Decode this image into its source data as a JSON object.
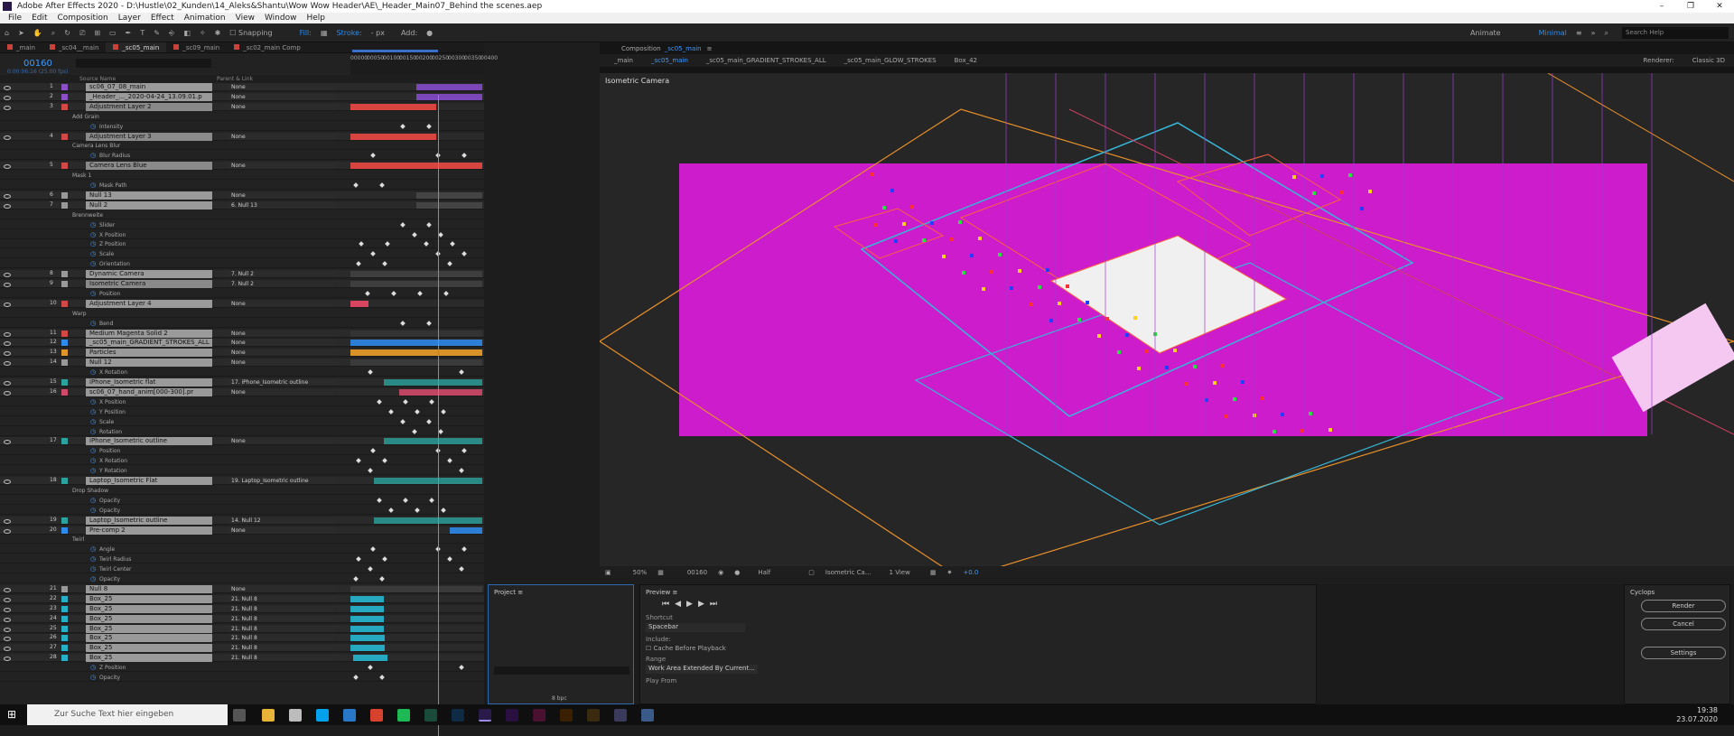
{
  "window": {
    "title": "Adobe After Effects 2020 - D:\\Hustle\\02_Kunden\\14_Aleks&Shantu\\Wow Wow Header\\AE\\_Header_Main07_Behind the scenes.aep"
  },
  "menu": [
    "File",
    "Edit",
    "Composition",
    "Layer",
    "Effect",
    "Animation",
    "View",
    "Window",
    "Help"
  ],
  "toolbar": {
    "snapping": "Snapping",
    "fill": "Fill:",
    "stroke": "Stroke:",
    "px": "- px",
    "add": "Add:",
    "workspace_animate": "Animate",
    "workspace_minimal": "Minimal",
    "search_placeholder": "Search Help"
  },
  "timeline": {
    "tabs": [
      {
        "label": "_main",
        "color": "#c8433a"
      },
      {
        "label": "_sc04__main",
        "color": "#c8433a"
      },
      {
        "label": "_sc05_main",
        "color": "#c8433a"
      },
      {
        "label": "_sc09_main",
        "color": "#c8433a"
      },
      {
        "label": "_sc02_main Comp",
        "color": "#c8433a"
      }
    ],
    "timecode": "00160",
    "timecode_sub": "0:00:06:16 (25.00 fps)",
    "ruler": [
      "00000",
      "00050",
      "00100",
      "00150",
      "00200",
      "00250",
      "00300",
      "00350",
      "00400"
    ],
    "header": {
      "source": "Source Name",
      "parent": "Parent & Link"
    },
    "rows": [
      {
        "n": "1",
        "name": "sc06_07_08_main",
        "parent": "None",
        "color": "#8b4fc7",
        "bar": [
          50,
          100
        ],
        "barcolor": "#7a46b8",
        "kind": "layer"
      },
      {
        "n": "2",
        "name": "_Header_..._2020-04-24_13.09.01.p",
        "parent": "None",
        "color": "#8b4fc7",
        "bar": [
          50,
          100
        ],
        "barcolor": "#7a46b8",
        "kind": "layer"
      },
      {
        "n": "3",
        "name": "Adjustment Layer 2",
        "parent": "None",
        "color": "#d24845",
        "bar": [
          0,
          65
        ],
        "barcolor": "#d84540",
        "kind": "sel"
      },
      {
        "n": "",
        "name": "Add Grain",
        "kind": "group"
      },
      {
        "n": "",
        "name": "Intensity",
        "kind": "prop"
      },
      {
        "n": "4",
        "name": "Adjustment Layer 3",
        "parent": "None",
        "color": "#d24845",
        "bar": [
          0,
          65
        ],
        "barcolor": "#d84540",
        "kind": "sel"
      },
      {
        "n": "",
        "name": "Camera Lens Blur",
        "kind": "group"
      },
      {
        "n": "",
        "name": "Blur Radius",
        "kind": "prop"
      },
      {
        "n": "5",
        "name": "Camera Lens Blue",
        "parent": "None",
        "color": "#d24845",
        "bar": [
          0,
          100
        ],
        "barcolor": "#d84540",
        "kind": "sel"
      },
      {
        "n": "",
        "name": "Mask 1",
        "kind": "group"
      },
      {
        "n": "",
        "name": "Mask Path",
        "kind": "prop"
      },
      {
        "n": "6",
        "name": "Null 13",
        "parent": "None",
        "color": "#999999",
        "bar": [
          50,
          100
        ],
        "barcolor": "#444444",
        "kind": "layer"
      },
      {
        "n": "7",
        "name": "Null 2",
        "parent": "6. Null 13",
        "color": "#999999",
        "bar": [
          50,
          100
        ],
        "barcolor": "#444444",
        "kind": "layer"
      },
      {
        "n": "",
        "name": "Brennweite",
        "kind": "group"
      },
      {
        "n": "",
        "name": "Slider",
        "kind": "prop"
      },
      {
        "n": "",
        "name": "X Position",
        "kind": "prop"
      },
      {
        "n": "",
        "name": "Z Position",
        "kind": "prop"
      },
      {
        "n": "",
        "name": "Scale",
        "kind": "prop"
      },
      {
        "n": "",
        "name": "Orientation",
        "kind": "prop"
      },
      {
        "n": "8",
        "name": "Dynamic Camera",
        "parent": "7. Null 2",
        "color": "#999999",
        "bar": [
          0,
          100
        ],
        "barcolor": "#3e3e3e",
        "kind": "layer"
      },
      {
        "n": "9",
        "name": "Isometric Camera",
        "parent": "7. Null 2",
        "color": "#999999",
        "bar": [
          0,
          100
        ],
        "barcolor": "#3e3e3e",
        "kind": "sel"
      },
      {
        "n": "",
        "name": "Position",
        "kind": "prop"
      },
      {
        "n": "10",
        "name": "Adjustment Layer 4",
        "parent": "None",
        "color": "#d24845",
        "bar": [
          0,
          14
        ],
        "barcolor": "#d84560",
        "kind": "layer"
      },
      {
        "n": "",
        "name": "Warp",
        "kind": "group"
      },
      {
        "n": "",
        "name": "Bend",
        "kind": "prop"
      },
      {
        "n": "11",
        "name": "Medium Magenta Solid 2",
        "parent": "None",
        "color": "#d24845",
        "bar": [
          0,
          100
        ],
        "barcolor": "#333333",
        "kind": "layer"
      },
      {
        "n": "12",
        "name": "_sc05_main_GRADIENT_STROKES_ALL",
        "parent": "None",
        "color": "#2d8ceb",
        "bar": [
          0,
          100
        ],
        "barcolor": "#2d7fd6",
        "kind": "layer"
      },
      {
        "n": "13",
        "name": "Particles",
        "parent": "None",
        "color": "#e0952a",
        "bar": [
          0,
          100
        ],
        "barcolor": "#d89228",
        "kind": "layer"
      },
      {
        "n": "14",
        "name": "Null 12",
        "parent": "None",
        "color": "#999999",
        "bar": [
          0,
          100
        ],
        "barcolor": "#3a3a3a",
        "kind": "layer"
      },
      {
        "n": "",
        "name": "X Rotation",
        "kind": "prop"
      },
      {
        "n": "15",
        "name": "iPhone_Isometric flat",
        "parent": "17. iPhone_Isometric outline",
        "color": "#2aa39e",
        "bar": [
          25,
          100
        ],
        "barcolor": "#2a8b86",
        "kind": "layer"
      },
      {
        "n": "16",
        "name": "sc06_07_hand_anim[000-300].pr",
        "parent": "None",
        "color": "#d24868",
        "bar": [
          37,
          100
        ],
        "barcolor": "#c04562",
        "kind": "layer"
      },
      {
        "n": "",
        "name": "X Position",
        "kind": "prop"
      },
      {
        "n": "",
        "name": "Y Position",
        "kind": "prop"
      },
      {
        "n": "",
        "name": "Scale",
        "kind": "prop"
      },
      {
        "n": "",
        "name": "Rotation",
        "kind": "prop"
      },
      {
        "n": "17",
        "name": "iPhone_Isometric outline",
        "parent": "None",
        "color": "#2aa39e",
        "bar": [
          25,
          100
        ],
        "barcolor": "#2a8b86",
        "kind": "layer"
      },
      {
        "n": "",
        "name": "Position",
        "kind": "prop"
      },
      {
        "n": "",
        "name": "X Rotation",
        "kind": "prop"
      },
      {
        "n": "",
        "name": "Y Rotation",
        "kind": "prop"
      },
      {
        "n": "18",
        "name": "Laptop_Isometric Flat",
        "parent": "19. Laptop_Isometric outline",
        "color": "#2aa39e",
        "bar": [
          18,
          100
        ],
        "barcolor": "#2a8b86",
        "kind": "layer"
      },
      {
        "n": "",
        "name": "Drop Shadow",
        "kind": "group"
      },
      {
        "n": "",
        "name": "Opacity",
        "kind": "prop"
      },
      {
        "n": "",
        "name": "Opacity",
        "kind": "prop"
      },
      {
        "n": "19",
        "name": "Laptop_Isometric outline",
        "parent": "14. Null 12",
        "color": "#2aa39e",
        "bar": [
          18,
          100
        ],
        "barcolor": "#2a8b86",
        "kind": "layer"
      },
      {
        "n": "20",
        "name": "Pre-comp 2",
        "parent": "None",
        "color": "#2d8ceb",
        "bar": [
          75,
          100
        ],
        "barcolor": "#2d7fd6",
        "kind": "layer"
      },
      {
        "n": "",
        "name": "Twirl",
        "kind": "group"
      },
      {
        "n": "",
        "name": "Angle",
        "kind": "prop"
      },
      {
        "n": "",
        "name": "Twirl Radius",
        "kind": "prop"
      },
      {
        "n": "",
        "name": "Twirl Center",
        "kind": "prop"
      },
      {
        "n": "",
        "name": "Opacity",
        "kind": "prop"
      },
      {
        "n": "21",
        "name": "Null 8",
        "parent": "None",
        "color": "#999999",
        "bar": [
          0,
          100
        ],
        "barcolor": "#3a3a3a",
        "kind": "layer"
      },
      {
        "n": "22",
        "name": "Box_25",
        "parent": "21. Null 8",
        "color": "#26b0c8",
        "bar": [
          0,
          25
        ],
        "barcolor": "#26a8c0",
        "kind": "layer"
      },
      {
        "n": "23",
        "name": "Box_25",
        "parent": "21. Null 8",
        "color": "#26b0c8",
        "bar": [
          0,
          25
        ],
        "barcolor": "#26a8c0",
        "kind": "layer"
      },
      {
        "n": "24",
        "name": "Box_25",
        "parent": "21. Null 8",
        "color": "#26b0c8",
        "bar": [
          0,
          25
        ],
        "barcolor": "#26a8c0",
        "kind": "layer"
      },
      {
        "n": "25",
        "name": "Box_25",
        "parent": "21. Null 8",
        "color": "#26b0c8",
        "bar": [
          0,
          25
        ],
        "barcolor": "#26a8c0",
        "kind": "layer"
      },
      {
        "n": "26",
        "name": "Box_25",
        "parent": "21. Null 8",
        "color": "#26b0c8",
        "bar": [
          0,
          26
        ],
        "barcolor": "#26a8c0",
        "kind": "layer"
      },
      {
        "n": "27",
        "name": "Box_25",
        "parent": "21. Null 8",
        "color": "#26b0c8",
        "bar": [
          0,
          26
        ],
        "barcolor": "#26a8c0",
        "kind": "layer"
      },
      {
        "n": "28",
        "name": "Box_25",
        "parent": "21. Null 8",
        "color": "#26b0c8",
        "bar": [
          2,
          28
        ],
        "barcolor": "#26a8c0",
        "kind": "layer"
      },
      {
        "n": "",
        "name": "Z Position",
        "kind": "prop"
      },
      {
        "n": "",
        "name": "Opacity",
        "kind": "prop"
      }
    ]
  },
  "composition": {
    "tab": "_sc05_main",
    "tab_prefix": "Composition",
    "flow": [
      "_main",
      "_sc05_main",
      "_sc05_main_GRADIENT_STROKES_ALL",
      "_sc05_main_GLOW_STROKES",
      "Box_42"
    ],
    "renderer_label": "Renderer:",
    "renderer_value": "Classic 3D",
    "camera_label": "Isometric Camera",
    "viewer_bar": {
      "zoom": "50%",
      "frame": "00160",
      "resolution": "Half",
      "camera": "Isometric Ca...",
      "view": "1 View",
      "exposure": "+0.0"
    }
  },
  "project": {
    "title": "Project",
    "bpc": "8 bpc"
  },
  "preview": {
    "title": "Preview",
    "shortcut_label": "Shortcut",
    "shortcut_value": "Spacebar",
    "include_label": "Include:",
    "cache_label": "Cache Before Playback",
    "range_label": "Range",
    "range_value": "Work Area Extended By Current...",
    "play_from": "Play From"
  },
  "cyclops": {
    "title": "Cyclops",
    "render": "Render",
    "cancel": "Cancel",
    "settings": "Settings"
  },
  "taskbar": {
    "search_placeholder": "Zur Suche Text hier eingeben",
    "time": "19:38",
    "date": "23.07.2020"
  },
  "colors": {
    "accent": "#2d8ceb",
    "magenta": "#cc1ccc",
    "taskbar": "#0f0f0f"
  }
}
